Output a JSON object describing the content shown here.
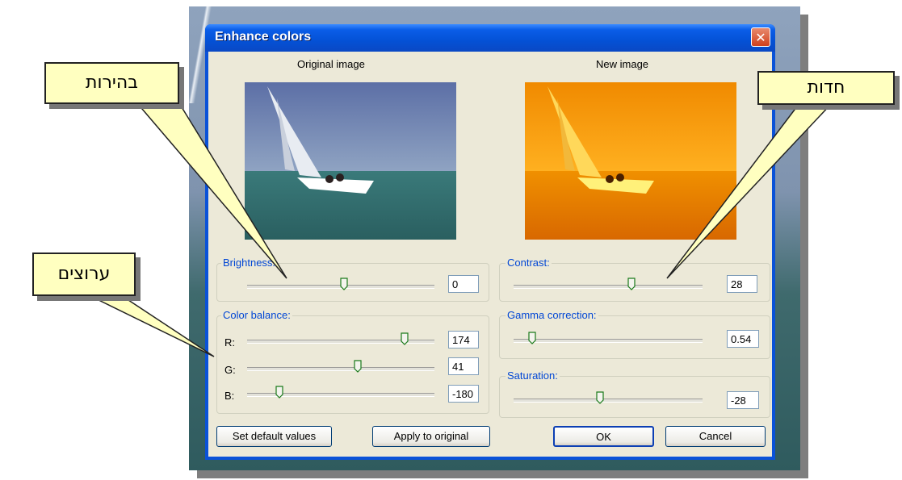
{
  "window": {
    "title": "Enhance colors"
  },
  "icons": {
    "close": "close-icon"
  },
  "images": {
    "original_label": "Original image",
    "new_label": "New image"
  },
  "brightness": {
    "label": "Brightness:",
    "value": "0"
  },
  "contrast": {
    "label": "Contrast:",
    "value": "28"
  },
  "color_balance": {
    "label": "Color balance:",
    "r_label": "R:",
    "r_value": "174",
    "g_label": "G:",
    "g_value": "41",
    "b_label": "B:",
    "b_value": "-180"
  },
  "gamma": {
    "label": "Gamma correction:",
    "value": "0.54"
  },
  "saturation": {
    "label": "Saturation:",
    "value": "-28"
  },
  "buttons": {
    "set_default": "Set default values",
    "apply": "Apply to original",
    "ok": "OK",
    "cancel": "Cancel"
  },
  "callouts": {
    "brightness": "בהירות",
    "sharpness": "חדות",
    "channels": "ערוצים"
  },
  "colors": {
    "callout_bg": "#ffffc0",
    "titlebar": "#0451d6",
    "group_title": "#0046d5"
  }
}
